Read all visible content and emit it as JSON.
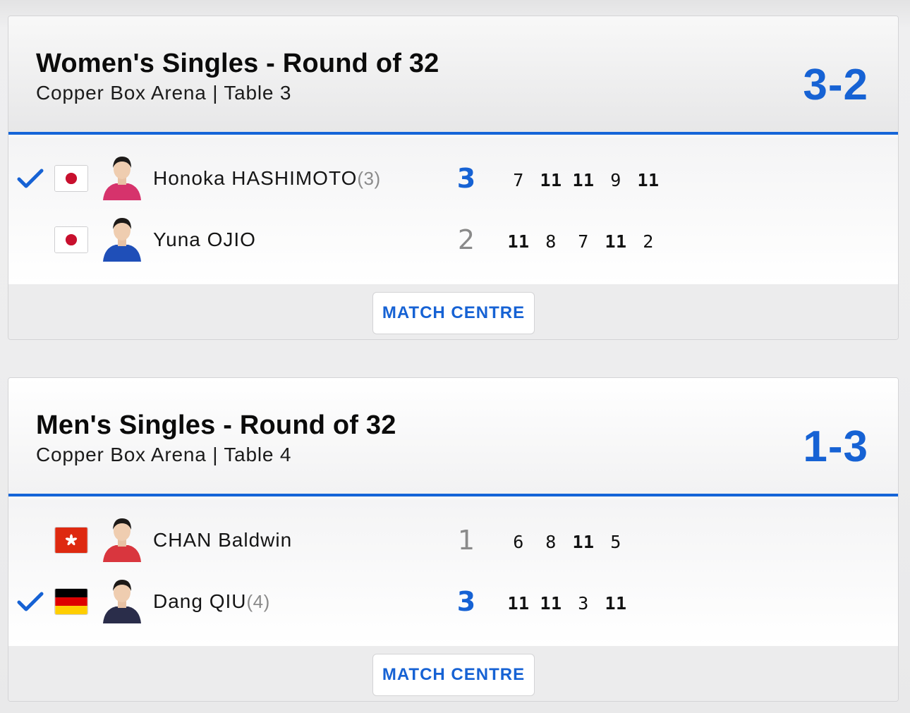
{
  "matches": [
    {
      "title": "Women's Singles - Round of 32",
      "venue": "Copper Box Arena | Table 3",
      "final_score": "3-2",
      "players": [
        {
          "name": "Honoka HASHIMOTO",
          "seed": "(3)",
          "flag": "japan-flag",
          "winner": true,
          "games_won": "3",
          "scores": [
            {
              "v": "7",
              "won": false
            },
            {
              "v": "11",
              "won": true
            },
            {
              "v": "11",
              "won": true
            },
            {
              "v": "9",
              "won": false
            },
            {
              "v": "11",
              "won": true
            }
          ]
        },
        {
          "name": "Yuna OJIO",
          "seed": "",
          "flag": "japan-flag",
          "winner": false,
          "games_won": "2",
          "scores": [
            {
              "v": "11",
              "won": true
            },
            {
              "v": "8",
              "won": false
            },
            {
              "v": "7",
              "won": false
            },
            {
              "v": "11",
              "won": true
            },
            {
              "v": "2",
              "won": false
            }
          ]
        }
      ],
      "button_label": "MATCH CENTRE"
    },
    {
      "title": "Men's Singles - Round of 32",
      "venue": "Copper Box Arena | Table 4",
      "final_score": "1-3",
      "players": [
        {
          "name": "CHAN Baldwin",
          "seed": "",
          "flag": "hong-kong-flag",
          "winner": false,
          "games_won": "1",
          "scores": [
            {
              "v": "6",
              "won": false
            },
            {
              "v": "8",
              "won": false
            },
            {
              "v": "11",
              "won": true
            },
            {
              "v": "5",
              "won": false
            }
          ]
        },
        {
          "name": "Dang QIU",
          "seed": "(4)",
          "flag": "germany-flag",
          "winner": true,
          "games_won": "3",
          "scores": [
            {
              "v": "11",
              "won": true
            },
            {
              "v": "11",
              "won": true
            },
            {
              "v": "3",
              "won": false
            },
            {
              "v": "11",
              "won": true
            }
          ]
        }
      ],
      "button_label": "MATCH CENTRE"
    }
  ],
  "colors": {
    "accent": "#1662d4",
    "jersey_pink": "#d6336c",
    "jersey_blue": "#1f4fb8",
    "jersey_red": "#d9363e",
    "jersey_navy": "#2a2d4a"
  }
}
